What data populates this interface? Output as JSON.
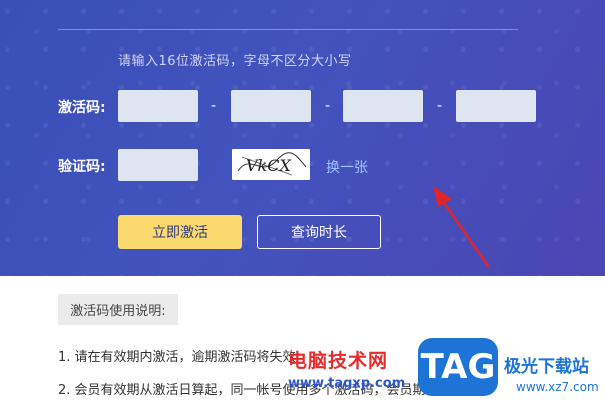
{
  "activation": {
    "hint": "请输入16位激活码，字母不区分大小写",
    "code_label": "激活码:",
    "code_values": [
      "",
      "",
      "",
      ""
    ],
    "dash": "-",
    "verify_label": "验证码:",
    "verify_value": "",
    "captcha_text": "VkCX",
    "refresh_label": "换一张",
    "activate_button": "立即激活",
    "query_button": "查询时长"
  },
  "usage": {
    "title": "激活码使用说明:",
    "items": [
      "1. 请在有效期内激活，逾期激活码将失效;",
      "2. 会员有效期从激活日算起，同一帐号使用多个激活码，会员期自动延长;"
    ]
  },
  "watermark": {
    "brand": "电脑技术网",
    "url": "www.tagxp.com",
    "logo": "TAG",
    "site": "极光下载站",
    "site_url": "www.xz7.com"
  },
  "colors": {
    "hero_bg": "#4050b8",
    "activate_bg": "#fcd96e",
    "link": "#9fc3ff",
    "arrow": "#e0252b"
  }
}
